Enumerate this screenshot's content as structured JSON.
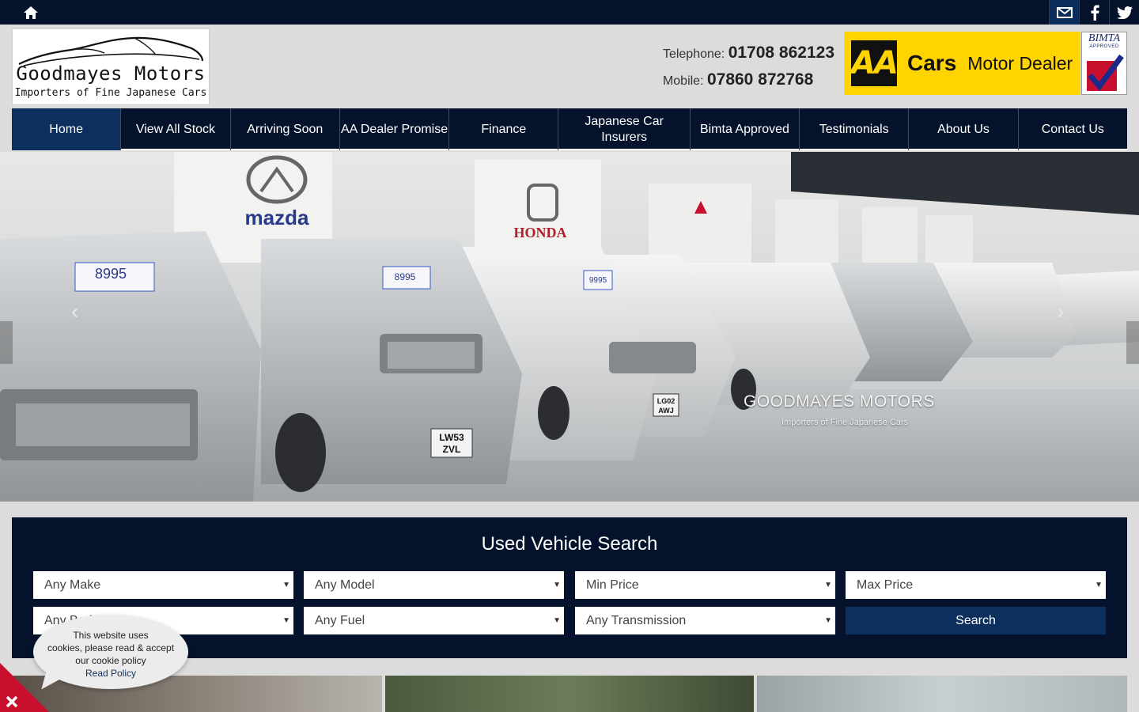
{
  "topbar": {
    "home_icon": "home-icon",
    "social": [
      {
        "name": "email-icon"
      },
      {
        "name": "facebook-icon"
      },
      {
        "name": "twitter-icon"
      }
    ]
  },
  "logo": {
    "name": "Goodmayes Motors",
    "tagline": "Importers of Fine Japanese Cars"
  },
  "contact": {
    "telephone_label": "Telephone:",
    "telephone": "01708 862123",
    "mobile_label": "Mobile:",
    "mobile": "07860 872768"
  },
  "aa_badge": {
    "logo": "AA",
    "cars": "Cars",
    "dealer": "Motor Dealer"
  },
  "bimta_badge": {
    "title": "BIMTA",
    "subtitle": "APPROVED"
  },
  "nav": {
    "items": [
      {
        "label": "Home",
        "active": true
      },
      {
        "label": "View All Stock"
      },
      {
        "label": "Arriving Soon"
      },
      {
        "label": "AA Dealer Promise"
      },
      {
        "label": "Finance"
      },
      {
        "label": "Japanese Car Insurers"
      },
      {
        "label": "Bimta Approved"
      },
      {
        "label": "Testimonials"
      },
      {
        "label": "About Us"
      },
      {
        "label": "Contact Us"
      }
    ]
  },
  "hero": {
    "prev": "‹",
    "next": "›",
    "brand": "GOODMAYES MOTORS",
    "brand_sub": "Importers of Fine Japanese Cars",
    "signs": [
      "mazda",
      "HONDA"
    ],
    "price_tags": [
      "8995",
      "8995",
      "9995"
    ],
    "plates": [
      "LW53 ZVL",
      "LG02 AWJ"
    ]
  },
  "search": {
    "title": "Used Vehicle Search",
    "make": "Any Make",
    "model": "Any Model",
    "min_price": "Min Price",
    "max_price": "Max Price",
    "body": "Any Body",
    "fuel": "Any Fuel",
    "transmission": "Any Transmission",
    "button": "Search"
  },
  "cookie": {
    "line1": "This website uses",
    "line2": "cookies, please read & accept",
    "line3": "our cookie policy",
    "link": "Read Policy"
  },
  "colors": {
    "navy": "#04132b",
    "active_blue": "#0d2f5e",
    "aa_yellow": "#ffd400",
    "close_red": "#c8102e"
  }
}
